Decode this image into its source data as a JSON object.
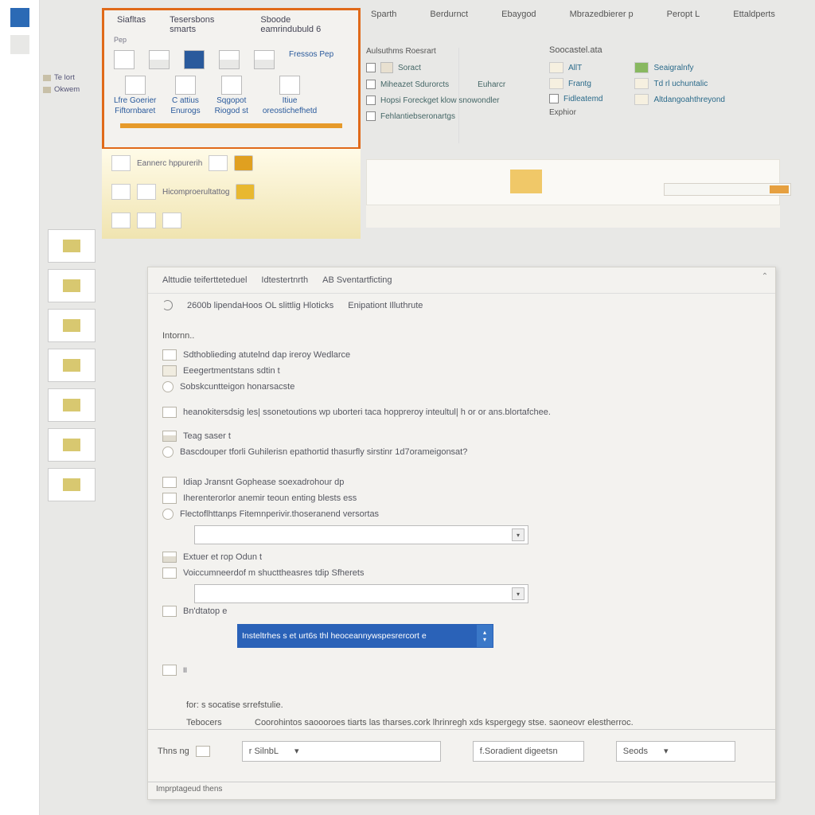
{
  "rail": {
    "blocks": 2
  },
  "tabs_right": [
    "Sparth",
    "Berdurnct",
    "Ebaygod",
    "Mbrazedbierer p",
    "Peropt L",
    "Ettaldperts"
  ],
  "ribbon_top": {
    "tabs": [
      "Siafltas",
      "Tesersbons smarts",
      "Sboode eamrindubuld 6"
    ],
    "small": "Pep",
    "groups_a": [
      "Fressos Pep"
    ],
    "groups_b": [
      {
        "l1": "Lfre Goerier",
        "l2": "Fiftornbaret"
      },
      {
        "l1": "C attius",
        "l2": "Enurogs"
      },
      {
        "l1": "Sqgopot",
        "l2": "Riogod st"
      },
      {
        "l1": "Itiue",
        "l2": "oreostichefhetd"
      }
    ]
  },
  "gallery": {
    "row1": "Eannerc hppurerih",
    "row2": "Hicomproerultattog"
  },
  "mid": {
    "hdr": "Aulsuthms Roesrart",
    "items": [
      "Soract",
      "Miheazet Sdurorcts",
      "Hopsi Foreckget klow snowondler",
      "Fehlantiebseronartgs"
    ],
    "col2": "Euharcr"
  },
  "right": {
    "hdr": "Soocastel.ata",
    "col1": [
      "AllT",
      "Frantg",
      "Fidleatemd",
      "Exphior"
    ],
    "col2": [
      "Seaigralnfy",
      "Td rl uchuntalic",
      "Altdangoahthreyond"
    ]
  },
  "left_outline": [
    "Te lort",
    "Okwem"
  ],
  "doc": {
    "tabs": [
      "Alttudie teifertteteduel",
      "Idtestertnrth",
      "AB Sventartficting"
    ],
    "sub": [
      "2600b lipendaHoos OL slittlig Hloticks",
      "Enipationt Illuthrute"
    ],
    "sec1_hdr": "Intornn..",
    "sec1": [
      "Sdthoblieding atutelnd dap ireroy Wedlarce",
      "Eeegertmentstans sdtin t",
      "Sobskcuntteigon honarsacste"
    ],
    "standalone1": "heanokitersdsig les| ssonetoutions wp uborteri taca hoppreroy inteultul| h or or ans.blortafchee.",
    "sec2_hdr": "Teag saser t",
    "sec2_line": "Bascdouper tforli Guhilerisn epathortid thasurfly sirstinr 1d7orameigonsat?",
    "sec3": [
      "Idiap Jransnt Gophease soexadrohour dp",
      "Iherenterorlor anemir teoun enting blests ess",
      "Flectoflhttanps Fitemnperivir.thoseranend versortas"
    ],
    "sec4": [
      "Extuer et rop Odun t",
      "Voiccumneerdof m shucttheasres tdip Sfherets"
    ],
    "sec4_field": "Bn'dtatop e",
    "dropdown_blue": "Insteltrhes s et urt6s thl heoceannywspesrercort e",
    "note_row": "for: s socatise srrefstulie.",
    "note_key": "Tebocers",
    "note_val": "Coorohintos saoooroes tiarts las tharses.cork lhrinregh xds kspergegy stse.   saoneovr elestherroc.",
    "bottom_lbl": "Thns   ng",
    "bottom_dd1": "r SilnbL",
    "bottom_dd2": "f.Soradient digeetsn",
    "bottom_dd3": "Seods",
    "status": "Imprptageud thens"
  }
}
